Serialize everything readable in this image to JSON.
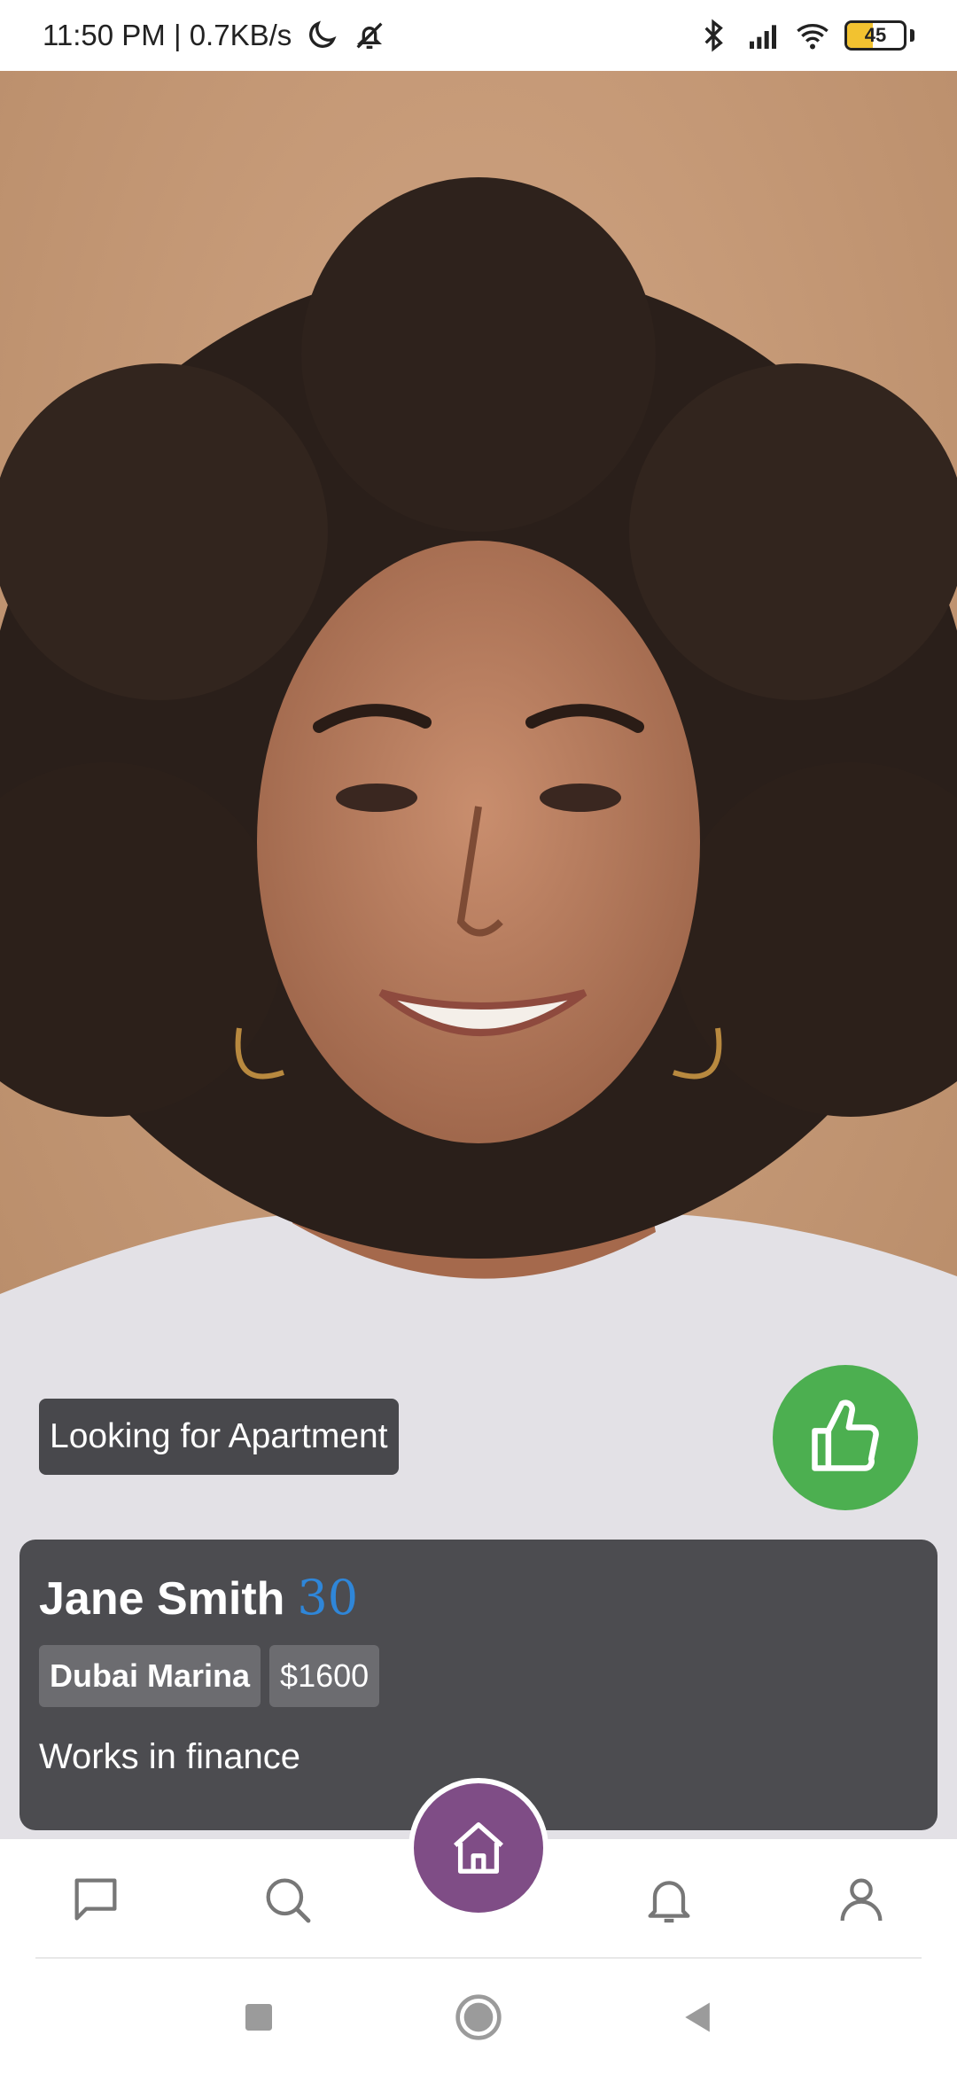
{
  "status_bar": {
    "time_speed": "11:50 PM | 0.7KB/s",
    "battery_level": "45",
    "icons": [
      "moon-icon",
      "bell-off-icon",
      "bluetooth-icon",
      "signal-icon",
      "wifi-icon",
      "battery-icon"
    ]
  },
  "profile": {
    "looking_for": "Looking for Apartment",
    "name": "Jane Smith",
    "age": "30",
    "location": "Dubai Marina",
    "budget": "$1600",
    "bio": "Works in finance"
  },
  "actions": {
    "like_icon": "thumbs-up-icon"
  },
  "bottom_nav": {
    "items": [
      "chat-icon",
      "search-icon",
      "home-icon",
      "bell-icon",
      "profile-icon"
    ]
  },
  "system_nav": {
    "buttons": [
      "recent-apps",
      "home",
      "back"
    ]
  },
  "colors": {
    "like": "#4caf50",
    "home_active": "#7f4d86",
    "age": "#2f86d8",
    "card_bg": "#424246"
  }
}
